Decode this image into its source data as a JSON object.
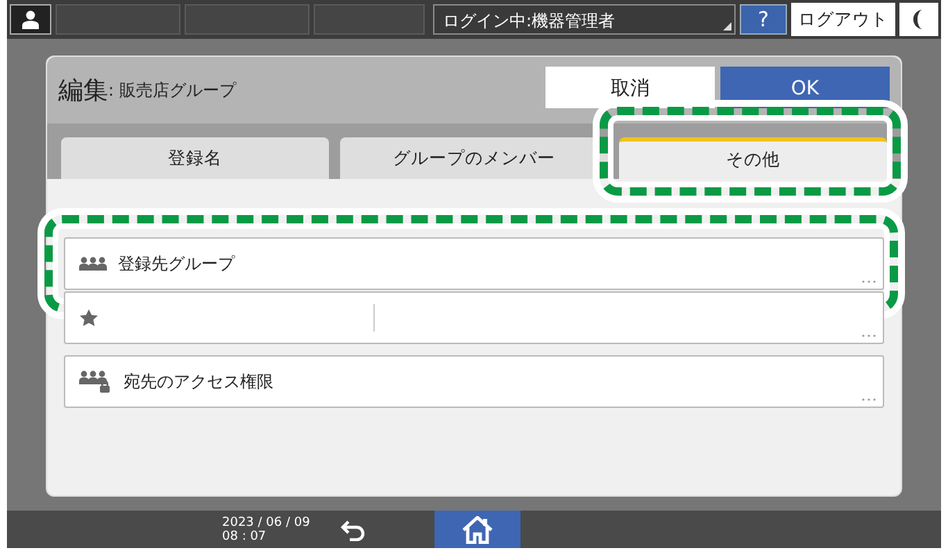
{
  "top_bar": {
    "login_status": "ログイン中:機器管理者",
    "help_label": "?",
    "logout_label": "ログアウト"
  },
  "dialog": {
    "title": "編集",
    "subtitle": ": 販売店グループ",
    "cancel_label": "取消",
    "ok_label": "OK"
  },
  "tabs": [
    {
      "label": "登録名",
      "selected": false,
      "highlighted": false
    },
    {
      "label": "グループのメンバー",
      "selected": false,
      "highlighted": false
    },
    {
      "label": "その他",
      "selected": true,
      "highlighted": true
    }
  ],
  "items": [
    {
      "kind": "group",
      "label": "登録先グループ",
      "highlighted": true
    },
    {
      "kind": "priority",
      "highlighted": false
    },
    {
      "kind": "access",
      "label": "宛先のアクセス権限",
      "highlighted": false
    }
  ],
  "bottom_bar": {
    "date": "2023 / 06 / 09",
    "time": "08 : 07"
  }
}
